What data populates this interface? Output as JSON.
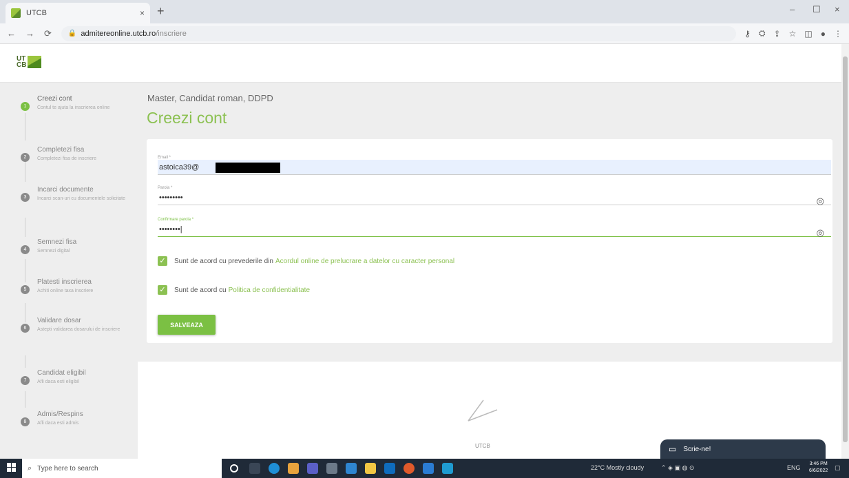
{
  "browser": {
    "tab_title": "UTCB",
    "tab_close": "×",
    "new_tab": "+",
    "url_host": "admitereonline.utcb.ro",
    "url_path": "/inscriere",
    "window_controls": [
      "–",
      "☐",
      "×"
    ]
  },
  "header": {
    "logo_text": "UT CB"
  },
  "sidebar": {
    "steps": [
      {
        "num": "1",
        "title": "Creezi cont",
        "desc": "Contul te ajuta la inscrierea online",
        "active": true
      },
      {
        "num": "2",
        "title": "Completezi fisa",
        "desc": "Completezi fisa de inscriere",
        "active": false
      },
      {
        "num": "3",
        "title": "Incarci documente",
        "desc": "Incarci scan-uri cu documentele solicitate",
        "active": false
      },
      {
        "num": "4",
        "title": "Semnezi fisa",
        "desc": "Semnezi digital",
        "active": false
      },
      {
        "num": "5",
        "title": "Platesti inscrierea",
        "desc": "Achiti online taxa inscriere",
        "active": false
      },
      {
        "num": "6",
        "title": "Validare dosar",
        "desc": "Astepti validarea dosarului de inscriere",
        "active": false
      },
      {
        "num": "7",
        "title": "Candidat eligibil",
        "desc": "Afli daca esti eligibil",
        "active": false
      },
      {
        "num": "8",
        "title": "Admis/Respins",
        "desc": "Afli daca esti admis",
        "active": false
      }
    ]
  },
  "main": {
    "subtitle": "Master, Candidat roman, DDPD",
    "title": "Creezi cont",
    "form": {
      "email_label": "Email *",
      "email_value": "astoica39@",
      "password_label": "Parola *",
      "password_value": "•••••••••",
      "confirm_label": "Confirmare parola *",
      "confirm_value": "••••••••|",
      "consent1_text": "Sunt de acord cu prevederile din",
      "consent1_link": "Acordul online de prelucrare a datelor cu caracter personal",
      "consent2_text": "Sunt de acord cu",
      "consent2_link": "Politica de confidentialitate",
      "save_label": "SALVEAZA"
    },
    "footer_text": "UTCB"
  },
  "chat": {
    "label": "Scrie-ne!"
  },
  "taskbar": {
    "search_placeholder": "Type here to search",
    "weather": "22°C Mostly cloudy",
    "lang": "ENG",
    "time": "3:46 PM",
    "date": "6/6/2022"
  }
}
